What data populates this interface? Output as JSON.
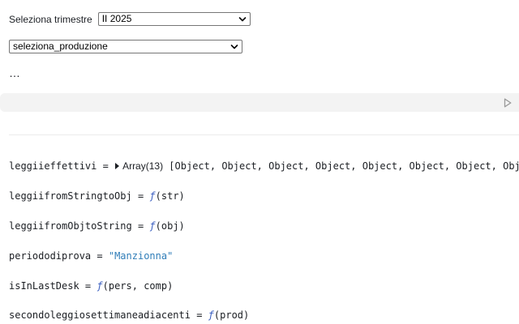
{
  "controls": {
    "quarter_label": "Seleziona trimestre",
    "quarter_value": "II 2025",
    "production_value": "seleziona_produzione"
  },
  "cell": {
    "collapsed_marker": "…"
  },
  "outputs": [
    {
      "name": "leggiieffettivi",
      "eq": " = ",
      "head": "Array(13)",
      "rest": " [Object, Object, Object, Object, Object, Object, Object, Object, Ob"
    },
    {
      "name": "leggiifromStringtoObj",
      "eq": " = ",
      "fn": "ƒ",
      "args": "(str)"
    },
    {
      "name": "leggiifromObjtoString",
      "eq": " = ",
      "fn": "ƒ",
      "args": "(obj)"
    },
    {
      "name": "periododiprova",
      "eq": " = ",
      "str": "\"Manzionna\""
    },
    {
      "name": "isInLastDesk",
      "eq": " = ",
      "fn": "ƒ",
      "args": "(pers, comp)"
    },
    {
      "name": "secondoleggiosettimaneadiacenti",
      "eq": " = ",
      "fn": "ƒ",
      "args": "(prod)"
    }
  ],
  "icons": {
    "chevron": "chevron-down-icon",
    "run": "play-icon"
  }
}
